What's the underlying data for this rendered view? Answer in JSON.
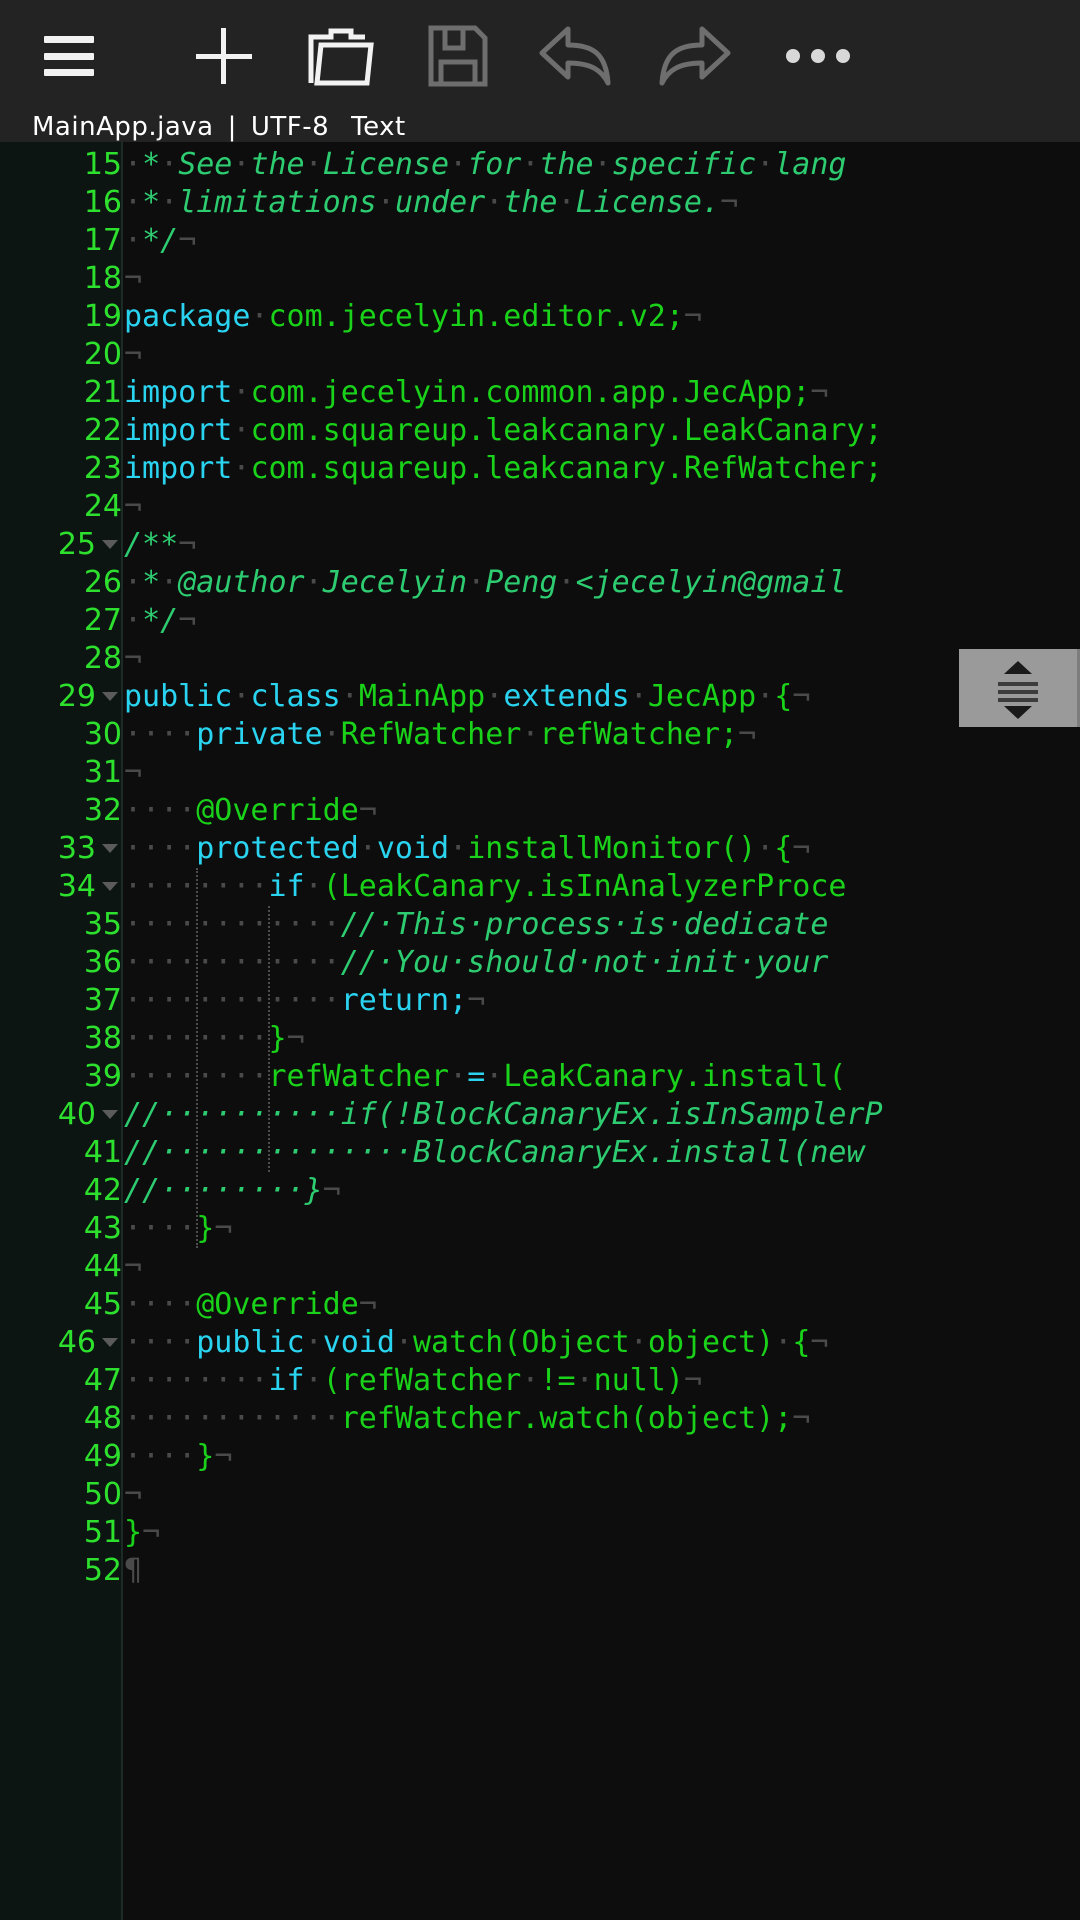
{
  "toolbar": {
    "buttons": [
      {
        "name": "menu-button",
        "icon": "hamburger-icon",
        "label": "Menu",
        "enabled": true
      },
      {
        "name": "new-file-button",
        "icon": "plus-icon",
        "label": "New",
        "enabled": true
      },
      {
        "name": "open-file-button",
        "icon": "folder-icon",
        "label": "Open",
        "enabled": true
      },
      {
        "name": "save-button",
        "icon": "save-icon",
        "label": "Save",
        "enabled": false
      },
      {
        "name": "undo-button",
        "icon": "undo-arrow-icon",
        "label": "Undo",
        "enabled": false
      },
      {
        "name": "redo-button",
        "icon": "redo-arrow-icon",
        "label": "Redo",
        "enabled": false
      },
      {
        "name": "overflow-menu-button",
        "icon": "more-dots-icon",
        "label": "More",
        "enabled": true
      }
    ]
  },
  "fileinfo": {
    "filename": "MainApp.java",
    "separator": "|",
    "encoding": "UTF-8",
    "filetype": "Text"
  },
  "editor": {
    "first_line": 15,
    "last_line": 52,
    "colors": {
      "background": "#0d0d0d",
      "gutter_background": "#0c1512",
      "line_number": "#2ee02e",
      "keyword": "#2ad4f0",
      "identifier": "#19d219",
      "comment": "#2ecc71",
      "whitespace": "#4a4a4a"
    },
    "lines": [
      {
        "n": 15,
        "fold": false,
        "tokens": [
          {
            "t": "·",
            "c": "ws"
          },
          {
            "t": "*",
            "c": "cm"
          },
          {
            "t": "·",
            "c": "ws"
          },
          {
            "t": "See",
            "c": "cm"
          },
          {
            "t": "·",
            "c": "ws"
          },
          {
            "t": "the",
            "c": "cm"
          },
          {
            "t": "·",
            "c": "ws"
          },
          {
            "t": "License",
            "c": "cm"
          },
          {
            "t": "·",
            "c": "ws"
          },
          {
            "t": "for",
            "c": "cm"
          },
          {
            "t": "·",
            "c": "ws"
          },
          {
            "t": "the",
            "c": "cm"
          },
          {
            "t": "·",
            "c": "ws"
          },
          {
            "t": "specific",
            "c": "cm"
          },
          {
            "t": "·",
            "c": "ws"
          },
          {
            "t": "lang",
            "c": "cm"
          }
        ]
      },
      {
        "n": 16,
        "fold": false,
        "tokens": [
          {
            "t": "·",
            "c": "ws"
          },
          {
            "t": "*",
            "c": "cm"
          },
          {
            "t": "·",
            "c": "ws"
          },
          {
            "t": "limitations",
            "c": "cm"
          },
          {
            "t": "·",
            "c": "ws"
          },
          {
            "t": "under",
            "c": "cm"
          },
          {
            "t": "·",
            "c": "ws"
          },
          {
            "t": "the",
            "c": "cm"
          },
          {
            "t": "·",
            "c": "ws"
          },
          {
            "t": "License.",
            "c": "cm"
          },
          {
            "t": "¬",
            "c": "ws"
          }
        ]
      },
      {
        "n": 17,
        "fold": false,
        "tokens": [
          {
            "t": "·",
            "c": "ws"
          },
          {
            "t": "*/",
            "c": "cm"
          },
          {
            "t": "¬",
            "c": "ws"
          }
        ]
      },
      {
        "n": 18,
        "fold": false,
        "tokens": [
          {
            "t": "¬",
            "c": "ws"
          }
        ]
      },
      {
        "n": 19,
        "fold": false,
        "tokens": [
          {
            "t": "package",
            "c": "kw"
          },
          {
            "t": "·",
            "c": "ws"
          },
          {
            "t": "com.jecelyin.editor.v2;",
            "c": "id"
          },
          {
            "t": "¬",
            "c": "ws"
          }
        ]
      },
      {
        "n": 20,
        "fold": false,
        "tokens": [
          {
            "t": "¬",
            "c": "ws"
          }
        ]
      },
      {
        "n": 21,
        "fold": false,
        "tokens": [
          {
            "t": "import",
            "c": "kw"
          },
          {
            "t": "·",
            "c": "ws"
          },
          {
            "t": "com.jecelyin.common.app.JecApp;",
            "c": "id"
          },
          {
            "t": "¬",
            "c": "ws"
          }
        ]
      },
      {
        "n": 22,
        "fold": false,
        "tokens": [
          {
            "t": "import",
            "c": "kw"
          },
          {
            "t": "·",
            "c": "ws"
          },
          {
            "t": "com.squareup.leakcanary.LeakCanary;",
            "c": "id"
          }
        ]
      },
      {
        "n": 23,
        "fold": false,
        "tokens": [
          {
            "t": "import",
            "c": "kw"
          },
          {
            "t": "·",
            "c": "ws"
          },
          {
            "t": "com.squareup.leakcanary.RefWatcher;",
            "c": "id"
          }
        ]
      },
      {
        "n": 24,
        "fold": false,
        "tokens": [
          {
            "t": "¬",
            "c": "ws"
          }
        ]
      },
      {
        "n": 25,
        "fold": true,
        "tokens": [
          {
            "t": "/**",
            "c": "cm"
          },
          {
            "t": "¬",
            "c": "ws"
          }
        ]
      },
      {
        "n": 26,
        "fold": false,
        "tokens": [
          {
            "t": "·",
            "c": "ws"
          },
          {
            "t": "*",
            "c": "cm"
          },
          {
            "t": "·",
            "c": "ws"
          },
          {
            "t": "@author",
            "c": "cm"
          },
          {
            "t": "·",
            "c": "ws"
          },
          {
            "t": "Jecelyin",
            "c": "cm"
          },
          {
            "t": "·",
            "c": "ws"
          },
          {
            "t": "Peng",
            "c": "cm"
          },
          {
            "t": "·",
            "c": "ws"
          },
          {
            "t": "<jecelyin@gmail",
            "c": "cm"
          }
        ]
      },
      {
        "n": 27,
        "fold": false,
        "tokens": [
          {
            "t": "·",
            "c": "ws"
          },
          {
            "t": "*/",
            "c": "cm"
          },
          {
            "t": "¬",
            "c": "ws"
          }
        ]
      },
      {
        "n": 28,
        "fold": false,
        "tokens": [
          {
            "t": "¬",
            "c": "ws"
          }
        ]
      },
      {
        "n": 29,
        "fold": true,
        "tokens": [
          {
            "t": "public",
            "c": "kw"
          },
          {
            "t": "·",
            "c": "ws"
          },
          {
            "t": "class",
            "c": "kw"
          },
          {
            "t": "·",
            "c": "ws"
          },
          {
            "t": "MainApp",
            "c": "id"
          },
          {
            "t": "·",
            "c": "ws"
          },
          {
            "t": "extends",
            "c": "kw"
          },
          {
            "t": "·",
            "c": "ws"
          },
          {
            "t": "JecApp",
            "c": "id"
          },
          {
            "t": "·",
            "c": "ws"
          },
          {
            "t": "{",
            "c": "id"
          },
          {
            "t": "¬",
            "c": "ws"
          }
        ]
      },
      {
        "n": 30,
        "fold": false,
        "tokens": [
          {
            "t": "····",
            "c": "ws"
          },
          {
            "t": "private",
            "c": "kw"
          },
          {
            "t": "·",
            "c": "ws"
          },
          {
            "t": "RefWatcher",
            "c": "id"
          },
          {
            "t": "·",
            "c": "ws"
          },
          {
            "t": "refWatcher;",
            "c": "id"
          },
          {
            "t": "¬",
            "c": "ws"
          }
        ]
      },
      {
        "n": 31,
        "fold": false,
        "tokens": [
          {
            "t": "¬",
            "c": "ws"
          }
        ]
      },
      {
        "n": 32,
        "fold": false,
        "tokens": [
          {
            "t": "····",
            "c": "ws"
          },
          {
            "t": "@Override",
            "c": "id"
          },
          {
            "t": "¬",
            "c": "ws"
          }
        ]
      },
      {
        "n": 33,
        "fold": true,
        "tokens": [
          {
            "t": "····",
            "c": "ws"
          },
          {
            "t": "protected",
            "c": "kw"
          },
          {
            "t": "·",
            "c": "ws"
          },
          {
            "t": "void",
            "c": "kw"
          },
          {
            "t": "·",
            "c": "ws"
          },
          {
            "t": "installMonitor()",
            "c": "id"
          },
          {
            "t": "·",
            "c": "ws"
          },
          {
            "t": "{",
            "c": "id"
          },
          {
            "t": "¬",
            "c": "ws"
          }
        ]
      },
      {
        "n": 34,
        "fold": true,
        "tokens": [
          {
            "t": "········",
            "c": "ws"
          },
          {
            "t": "if",
            "c": "kw"
          },
          {
            "t": "·",
            "c": "ws"
          },
          {
            "t": "(LeakCanary.isInAnalyzerProce",
            "c": "id"
          }
        ]
      },
      {
        "n": 35,
        "fold": false,
        "tokens": [
          {
            "t": "············",
            "c": "ws"
          },
          {
            "t": "//·This·process·is·dedicate",
            "c": "cm"
          }
        ]
      },
      {
        "n": 36,
        "fold": false,
        "tokens": [
          {
            "t": "············",
            "c": "ws"
          },
          {
            "t": "//·You·should·not·init·your",
            "c": "cm"
          }
        ]
      },
      {
        "n": 37,
        "fold": false,
        "tokens": [
          {
            "t": "············",
            "c": "ws"
          },
          {
            "t": "return;",
            "c": "kw"
          },
          {
            "t": "¬",
            "c": "ws"
          }
        ]
      },
      {
        "n": 38,
        "fold": false,
        "tokens": [
          {
            "t": "········",
            "c": "ws"
          },
          {
            "t": "}",
            "c": "id"
          },
          {
            "t": "¬",
            "c": "ws"
          }
        ]
      },
      {
        "n": 39,
        "fold": false,
        "tokens": [
          {
            "t": "········",
            "c": "ws"
          },
          {
            "t": "refWatcher",
            "c": "id"
          },
          {
            "t": "·",
            "c": "ws"
          },
          {
            "t": "=",
            "c": "op"
          },
          {
            "t": "·",
            "c": "ws"
          },
          {
            "t": "LeakCanary.install(",
            "c": "id"
          }
        ]
      },
      {
        "n": 40,
        "fold": true,
        "tokens": [
          {
            "t": "//··········if(!BlockCanaryEx.isInSamplerP",
            "c": "cm"
          }
        ]
      },
      {
        "n": 41,
        "fold": false,
        "tokens": [
          {
            "t": "//··············BlockCanaryEx.install(new",
            "c": "cm"
          }
        ]
      },
      {
        "n": 42,
        "fold": false,
        "tokens": [
          {
            "t": "//········}",
            "c": "cm"
          },
          {
            "t": "¬",
            "c": "ws"
          }
        ]
      },
      {
        "n": 43,
        "fold": false,
        "tokens": [
          {
            "t": "····",
            "c": "ws"
          },
          {
            "t": "}",
            "c": "id"
          },
          {
            "t": "¬",
            "c": "ws"
          }
        ]
      },
      {
        "n": 44,
        "fold": false,
        "tokens": [
          {
            "t": "¬",
            "c": "ws"
          }
        ]
      },
      {
        "n": 45,
        "fold": false,
        "tokens": [
          {
            "t": "····",
            "c": "ws"
          },
          {
            "t": "@Override",
            "c": "id"
          },
          {
            "t": "¬",
            "c": "ws"
          }
        ]
      },
      {
        "n": 46,
        "fold": true,
        "tokens": [
          {
            "t": "····",
            "c": "ws"
          },
          {
            "t": "public",
            "c": "kw"
          },
          {
            "t": "·",
            "c": "ws"
          },
          {
            "t": "void",
            "c": "kw"
          },
          {
            "t": "·",
            "c": "ws"
          },
          {
            "t": "watch(Object",
            "c": "id"
          },
          {
            "t": "·",
            "c": "ws"
          },
          {
            "t": "object)",
            "c": "id"
          },
          {
            "t": "·",
            "c": "ws"
          },
          {
            "t": "{",
            "c": "id"
          },
          {
            "t": "¬",
            "c": "ws"
          }
        ]
      },
      {
        "n": 47,
        "fold": false,
        "tokens": [
          {
            "t": "········",
            "c": "ws"
          },
          {
            "t": "if",
            "c": "kw"
          },
          {
            "t": "·",
            "c": "ws"
          },
          {
            "t": "(refWatcher",
            "c": "id"
          },
          {
            "t": "·",
            "c": "ws"
          },
          {
            "t": "!=",
            "c": "id"
          },
          {
            "t": "·",
            "c": "ws"
          },
          {
            "t": "null)",
            "c": "id"
          },
          {
            "t": "¬",
            "c": "ws"
          }
        ]
      },
      {
        "n": 48,
        "fold": false,
        "tokens": [
          {
            "t": "············",
            "c": "ws"
          },
          {
            "t": "refWatcher.watch(object);",
            "c": "id"
          },
          {
            "t": "¬",
            "c": "ws"
          }
        ]
      },
      {
        "n": 49,
        "fold": false,
        "tokens": [
          {
            "t": "····",
            "c": "ws"
          },
          {
            "t": "}",
            "c": "id"
          },
          {
            "t": "¬",
            "c": "ws"
          }
        ]
      },
      {
        "n": 50,
        "fold": false,
        "tokens": [
          {
            "t": "¬",
            "c": "ws"
          }
        ]
      },
      {
        "n": 51,
        "fold": false,
        "tokens": [
          {
            "t": "}",
            "c": "id"
          },
          {
            "t": "¬",
            "c": "ws"
          }
        ]
      },
      {
        "n": 52,
        "fold": false,
        "tokens": [
          {
            "t": "¶",
            "c": "ws"
          }
        ]
      }
    ]
  },
  "scrollbar": {
    "name": "vertical-scrollbar-thumb"
  }
}
